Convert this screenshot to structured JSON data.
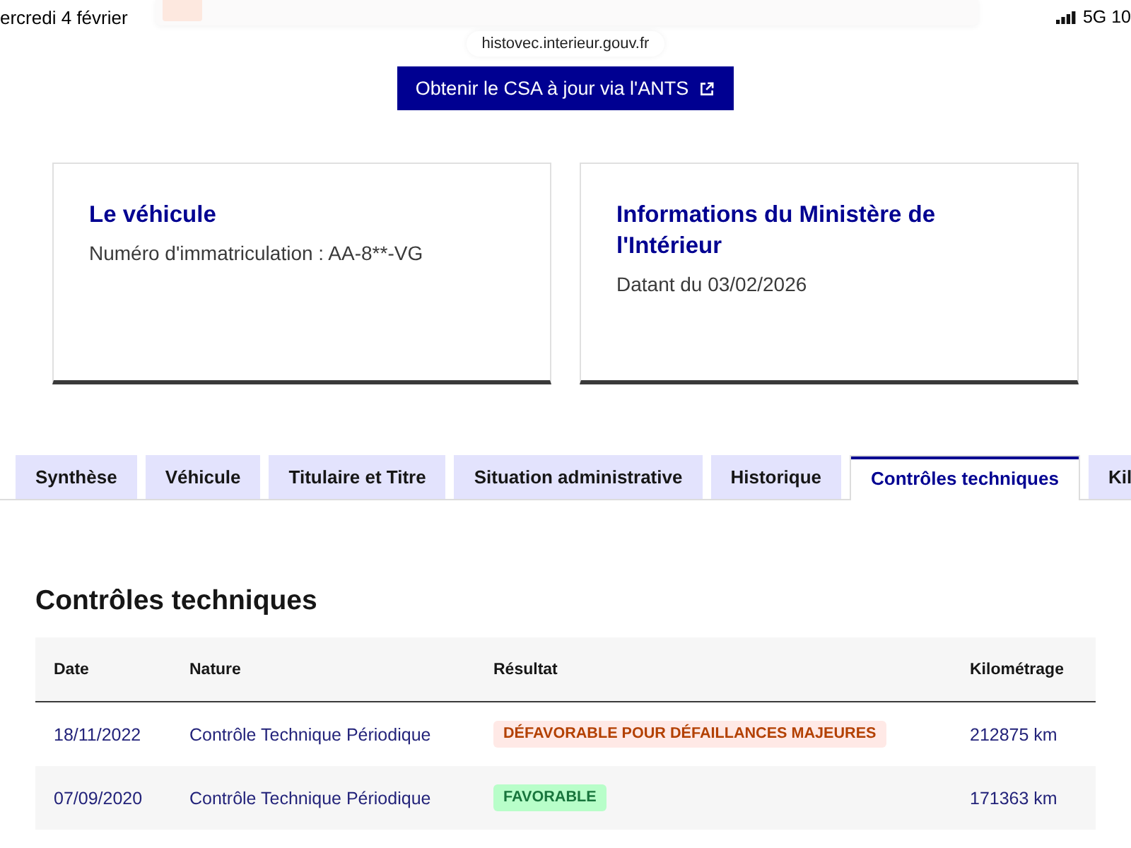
{
  "status_bar": {
    "date": "ercredi 4 février",
    "network": "5G 10"
  },
  "address_bar": {
    "url": "histovec.interieur.gouv.fr"
  },
  "action_button": {
    "label": "Obtenir le CSA à jour via l'ANTS"
  },
  "cards": [
    {
      "title": "Le véhicule",
      "text": "Numéro d'immatriculation : AA-8**-VG"
    },
    {
      "title": "Informations du Ministère de l'Intérieur",
      "text": "Datant du 03/02/2026"
    }
  ],
  "tabs": [
    {
      "label": "Synthèse",
      "selected": false
    },
    {
      "label": "Véhicule",
      "selected": false
    },
    {
      "label": "Titulaire et Titre",
      "selected": false
    },
    {
      "label": "Situation administrative",
      "selected": false
    },
    {
      "label": "Historique",
      "selected": false
    },
    {
      "label": "Contrôles techniques",
      "selected": true
    },
    {
      "label": "Kil",
      "selected": false
    }
  ],
  "section": {
    "title": "Contrôles techniques"
  },
  "table": {
    "columns": [
      "Date",
      "Nature",
      "Résultat",
      "Kilométrage"
    ],
    "rows": [
      {
        "date": "18/11/2022",
        "nature": "Contrôle Technique Périodique",
        "result": {
          "label": "DÉFAVORABLE POUR DÉFAILLANCES MAJEURES",
          "kind": "error"
        },
        "mileage": "212875 km"
      },
      {
        "date": "07/09/2020",
        "nature": "Contrôle Technique Périodique",
        "result": {
          "label": "FAVORABLE",
          "kind": "success"
        },
        "mileage": "171363 km"
      }
    ]
  }
}
